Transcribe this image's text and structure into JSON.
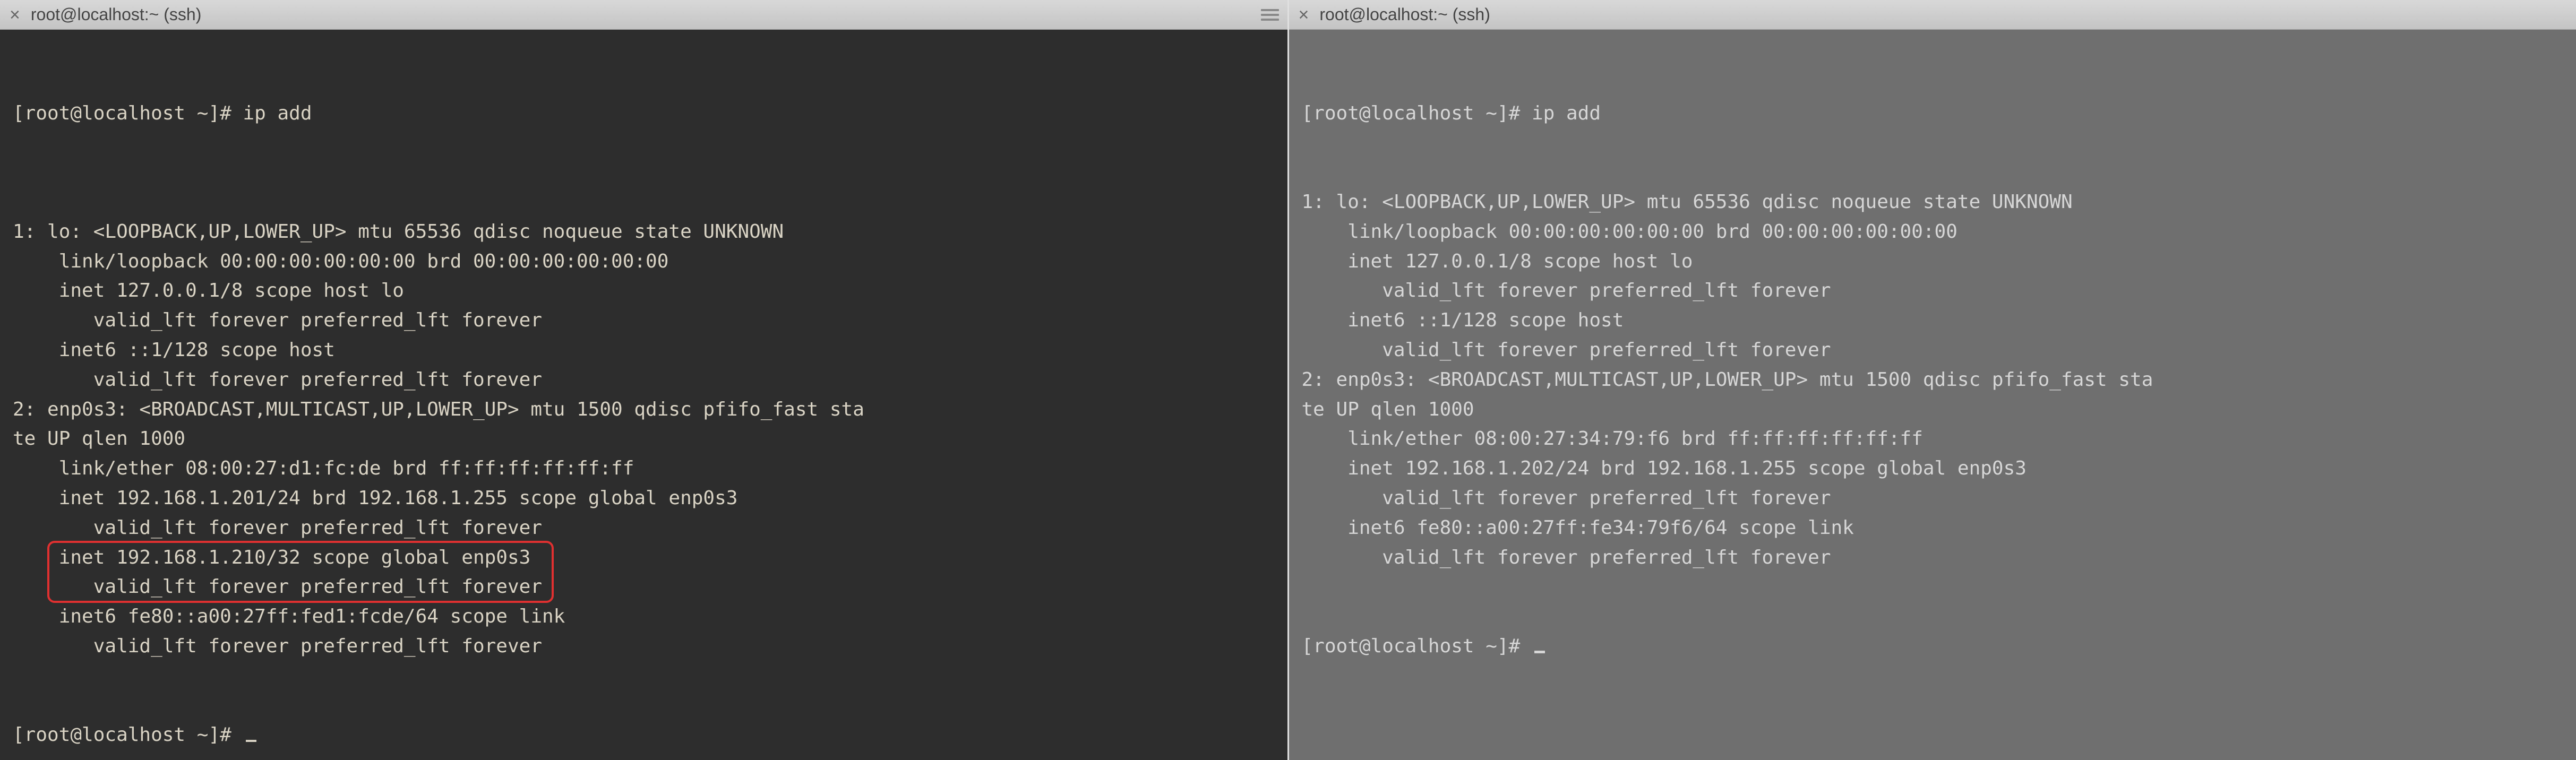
{
  "left": {
    "tab_title": "root@localhost:~ (ssh)",
    "prompt": "[root@localhost ~]# ",
    "command": "ip add",
    "lines": [
      "1: lo: <LOOPBACK,UP,LOWER_UP> mtu 65536 qdisc noqueue state UNKNOWN",
      "    link/loopback 00:00:00:00:00:00 brd 00:00:00:00:00:00",
      "    inet 127.0.0.1/8 scope host lo",
      "       valid_lft forever preferred_lft forever",
      "    inet6 ::1/128 scope host",
      "       valid_lft forever preferred_lft forever",
      "2: enp0s3: <BROADCAST,MULTICAST,UP,LOWER_UP> mtu 1500 qdisc pfifo_fast sta",
      "te UP qlen 1000",
      "    link/ether 08:00:27:d1:fc:de brd ff:ff:ff:ff:ff:ff",
      "    inet 192.168.1.201/24 brd 192.168.1.255 scope global enp0s3",
      "       valid_lft forever preferred_lft forever",
      "    inet 192.168.1.210/32 scope global enp0s3",
      "       valid_lft forever preferred_lft forever",
      "    inet6 fe80::a00:27ff:fed1:fcde/64 scope link",
      "       valid_lft forever preferred_lft forever"
    ],
    "highlight_lines": [
      11,
      12
    ]
  },
  "right": {
    "tab_title": "root@localhost:~ (ssh)",
    "prompt": "[root@localhost ~]# ",
    "command": "ip add",
    "lines": [
      "1: lo: <LOOPBACK,UP,LOWER_UP> mtu 65536 qdisc noqueue state UNKNOWN",
      "    link/loopback 00:00:00:00:00:00 brd 00:00:00:00:00:00",
      "    inet 127.0.0.1/8 scope host lo",
      "       valid_lft forever preferred_lft forever",
      "    inet6 ::1/128 scope host",
      "       valid_lft forever preferred_lft forever",
      "2: enp0s3: <BROADCAST,MULTICAST,UP,LOWER_UP> mtu 1500 qdisc pfifo_fast sta",
      "te UP qlen 1000",
      "    link/ether 08:00:27:34:79:f6 brd ff:ff:ff:ff:ff:ff",
      "    inet 192.168.1.202/24 brd 192.168.1.255 scope global enp0s3",
      "       valid_lft forever preferred_lft forever",
      "    inet6 fe80::a00:27ff:fe34:79f6/64 scope link",
      "       valid_lft forever preferred_lft forever"
    ]
  },
  "colors": {
    "highlight_border": "#e03030",
    "dark_bg": "#2d2d2d",
    "gray_bg": "#6f6f6f"
  }
}
